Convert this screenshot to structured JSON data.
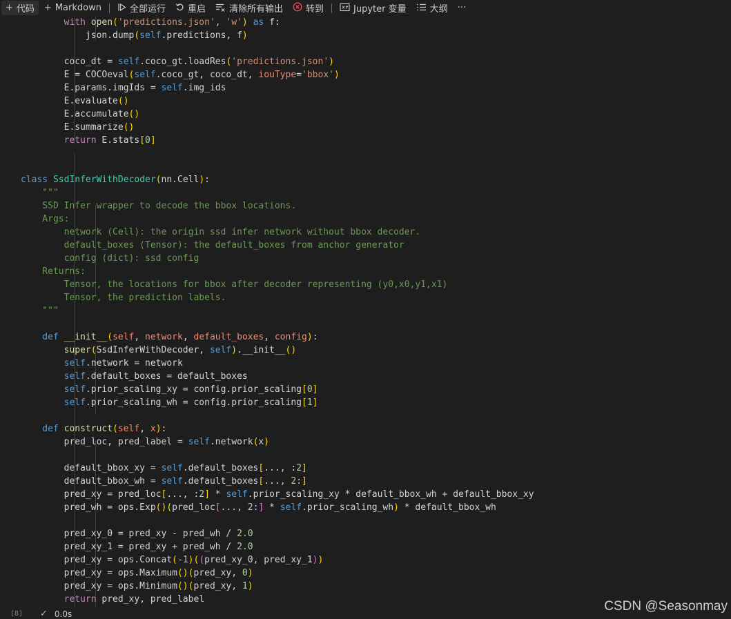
{
  "toolbar": {
    "code_label": "代码",
    "markdown_label": "Markdown",
    "run_all_label": "全部运行",
    "restart_label": "重启",
    "clear_outputs_label": "清除所有输出",
    "goto_label": "转到",
    "variables_label": "Jupyter 变量",
    "outline_label": "大纲",
    "more_label": "···"
  },
  "cell": {
    "execution_count": "[8]",
    "duration": "0.0s"
  },
  "code_lines": [
    [
      [
        "k",
        "        with "
      ],
      [
        "f",
        "open"
      ],
      [
        "p",
        "("
      ],
      [
        "s",
        "'predictions.json'"
      ],
      [
        "",
        ", "
      ],
      [
        "s",
        "'w'"
      ],
      [
        "p",
        ")"
      ],
      [
        "b",
        " as "
      ],
      [
        "",
        "f:"
      ]
    ],
    [
      [
        "",
        "            json.dump"
      ],
      [
        "p",
        "("
      ],
      [
        "b",
        "self"
      ],
      [
        "",
        ".predictions, f"
      ],
      [
        "p",
        ")"
      ]
    ],
    [
      [
        "",
        ""
      ]
    ],
    [
      [
        "",
        "        coco_dt = "
      ],
      [
        "b",
        "self"
      ],
      [
        "",
        ".coco_gt.loadRes"
      ],
      [
        "p",
        "("
      ],
      [
        "s",
        "'predictions.json'"
      ],
      [
        "p",
        ")"
      ]
    ],
    [
      [
        "",
        "        E = COCOeval"
      ],
      [
        "p",
        "("
      ],
      [
        "b",
        "self"
      ],
      [
        "",
        ".coco_gt, coco_dt, "
      ],
      [
        "pa",
        "iouType"
      ],
      [
        "",
        "="
      ],
      [
        "s",
        "'bbox'"
      ],
      [
        "p",
        ")"
      ]
    ],
    [
      [
        "",
        "        E.params.imgIds = "
      ],
      [
        "b",
        "self"
      ],
      [
        "",
        ".img_ids"
      ]
    ],
    [
      [
        "",
        "        E.evaluate"
      ],
      [
        "p",
        "()"
      ]
    ],
    [
      [
        "",
        "        E.accumulate"
      ],
      [
        "p",
        "()"
      ]
    ],
    [
      [
        "",
        "        E.summarize"
      ],
      [
        "p",
        "()"
      ]
    ],
    [
      [
        "k",
        "        return "
      ],
      [
        "",
        "E.stats"
      ],
      [
        "p",
        "["
      ],
      [
        "n",
        "0"
      ],
      [
        "p",
        "]"
      ]
    ],
    [
      [
        "",
        ""
      ]
    ],
    [
      [
        "",
        ""
      ]
    ],
    [
      [
        "b",
        "class "
      ],
      [
        "c",
        "SsdInferWithDecoder"
      ],
      [
        "p",
        "("
      ],
      [
        "",
        "nn.Cell"
      ],
      [
        "p",
        ")"
      ],
      [
        "",
        ":"
      ]
    ],
    [
      [
        "d",
        "    \"\"\""
      ]
    ],
    [
      [
        "d",
        "    SSD Infer wrapper to decode the bbox locations."
      ]
    ],
    [
      [
        "d",
        "    Args:"
      ]
    ],
    [
      [
        "d",
        "        network (Cell): the origin ssd infer network without bbox decoder."
      ]
    ],
    [
      [
        "d",
        "        default_boxes (Tensor): the default_boxes from anchor generator"
      ]
    ],
    [
      [
        "d",
        "        config (dict): ssd config"
      ]
    ],
    [
      [
        "d",
        "    Returns:"
      ]
    ],
    [
      [
        "d",
        "        Tensor, the locations for bbox after decoder representing (y0,x0,y1,x1)"
      ]
    ],
    [
      [
        "d",
        "        Tensor, the prediction labels."
      ]
    ],
    [
      [
        "d",
        "    \"\"\""
      ]
    ],
    [
      [
        "",
        ""
      ]
    ],
    [
      [
        "b",
        "    def "
      ],
      [
        "f",
        "__init__"
      ],
      [
        "p",
        "("
      ],
      [
        "pa",
        "self"
      ],
      [
        "",
        ", "
      ],
      [
        "pa",
        "network"
      ],
      [
        "",
        ", "
      ],
      [
        "pa",
        "default_boxes"
      ],
      [
        "",
        ", "
      ],
      [
        "pa",
        "config"
      ],
      [
        "p",
        ")"
      ],
      [
        "",
        ":"
      ]
    ],
    [
      [
        "f",
        "        super"
      ],
      [
        "p",
        "("
      ],
      [
        "",
        "SsdInferWithDecoder, "
      ],
      [
        "b",
        "self"
      ],
      [
        "p",
        ")"
      ],
      [
        "",
        ".__init__"
      ],
      [
        "p",
        "()"
      ]
    ],
    [
      [
        "b",
        "        self"
      ],
      [
        "",
        ".network = network"
      ]
    ],
    [
      [
        "b",
        "        self"
      ],
      [
        "",
        ".default_boxes = default_boxes"
      ]
    ],
    [
      [
        "b",
        "        self"
      ],
      [
        "",
        ".prior_scaling_xy = config.prior_scaling"
      ],
      [
        "p",
        "["
      ],
      [
        "n",
        "0"
      ],
      [
        "p",
        "]"
      ]
    ],
    [
      [
        "b",
        "        self"
      ],
      [
        "",
        ".prior_scaling_wh = config.prior_scaling"
      ],
      [
        "p",
        "["
      ],
      [
        "n",
        "1"
      ],
      [
        "p",
        "]"
      ]
    ],
    [
      [
        "",
        ""
      ]
    ],
    [
      [
        "b",
        "    def "
      ],
      [
        "f",
        "construct"
      ],
      [
        "p",
        "("
      ],
      [
        "pa",
        "self"
      ],
      [
        "",
        ", "
      ],
      [
        "pa",
        "x"
      ],
      [
        "p",
        ")"
      ],
      [
        "",
        ":"
      ]
    ],
    [
      [
        "",
        "        pred_loc, pred_label = "
      ],
      [
        "b",
        "self"
      ],
      [
        "",
        ".network"
      ],
      [
        "p",
        "("
      ],
      [
        "",
        "x"
      ],
      [
        "p",
        ")"
      ]
    ],
    [
      [
        "",
        ""
      ]
    ],
    [
      [
        "",
        "        default_bbox_xy = "
      ],
      [
        "b",
        "self"
      ],
      [
        "",
        ".default_boxes"
      ],
      [
        "p",
        "["
      ],
      [
        "",
        "..., :"
      ],
      [
        "n",
        "2"
      ],
      [
        "p",
        "]"
      ]
    ],
    [
      [
        "",
        "        default_bbox_wh = "
      ],
      [
        "b",
        "self"
      ],
      [
        "",
        ".default_boxes"
      ],
      [
        "p",
        "["
      ],
      [
        "",
        "..., "
      ],
      [
        "n",
        "2"
      ],
      [
        "",
        ":"
      ],
      [
        "p",
        "]"
      ]
    ],
    [
      [
        "",
        "        pred_xy = pred_loc"
      ],
      [
        "p",
        "["
      ],
      [
        "",
        "..., :"
      ],
      [
        "n",
        "2"
      ],
      [
        "p",
        "]"
      ],
      [
        "",
        " * "
      ],
      [
        "b",
        "self"
      ],
      [
        "",
        ".prior_scaling_xy * default_bbox_wh + default_bbox_xy"
      ]
    ],
    [
      [
        "",
        "        pred_wh = ops.Exp"
      ],
      [
        "p",
        "()"
      ],
      [
        "p",
        "("
      ],
      [
        "",
        "pred_loc"
      ],
      [
        "g",
        "["
      ],
      [
        "",
        "..., "
      ],
      [
        "n",
        "2"
      ],
      [
        "",
        ":"
      ],
      [
        "g",
        "]"
      ],
      [
        "",
        " * "
      ],
      [
        "b",
        "self"
      ],
      [
        "",
        ".prior_scaling_wh"
      ],
      [
        "p",
        ")"
      ],
      [
        "",
        " * default_bbox_wh"
      ]
    ],
    [
      [
        "",
        ""
      ]
    ],
    [
      [
        "",
        "        pred_xy_0 = pred_xy - pred_wh / "
      ],
      [
        "n",
        "2.0"
      ]
    ],
    [
      [
        "",
        "        pred_xy_1 = pred_xy + pred_wh / "
      ],
      [
        "n",
        "2.0"
      ]
    ],
    [
      [
        "",
        "        pred_xy = ops.Concat"
      ],
      [
        "p",
        "("
      ],
      [
        "",
        "-"
      ],
      [
        "n",
        "1"
      ],
      [
        "p",
        ")"
      ],
      [
        "p",
        "("
      ],
      [
        "g",
        "("
      ],
      [
        "",
        "pred_xy_0, pred_xy_1"
      ],
      [
        "g",
        ")"
      ],
      [
        "p",
        ")"
      ]
    ],
    [
      [
        "",
        "        pred_xy = ops.Maximum"
      ],
      [
        "p",
        "()"
      ],
      [
        "p",
        "("
      ],
      [
        "",
        "pred_xy, "
      ],
      [
        "n",
        "0"
      ],
      [
        "p",
        ")"
      ]
    ],
    [
      [
        "",
        "        pred_xy = ops.Minimum"
      ],
      [
        "p",
        "()"
      ],
      [
        "p",
        "("
      ],
      [
        "",
        "pred_xy, "
      ],
      [
        "n",
        "1"
      ],
      [
        "p",
        ")"
      ]
    ],
    [
      [
        "k",
        "        return "
      ],
      [
        "",
        "pred_xy, pred_label"
      ]
    ]
  ],
  "watermark": "CSDN @Seasonmay"
}
